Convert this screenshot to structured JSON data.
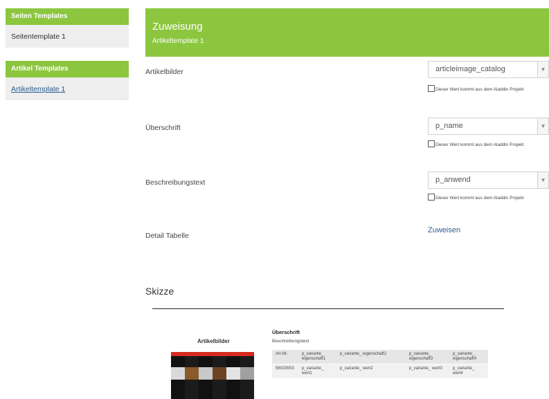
{
  "sidebar": {
    "page_templates_heading": "Seiten Templates",
    "page_template_item": "Seitentemplate 1",
    "article_templates_heading": "Artikel Templates",
    "article_template_item": "Artikeltemplate 1"
  },
  "header": {
    "title": "Zuweisung",
    "subtitle": "Artikeltemplate 1"
  },
  "fields": [
    {
      "label": "Artikelbilder",
      "value": "articleimage_catalog",
      "checkbox_label": "Dieser Wert kommt aus dem Aladdin Projekt"
    },
    {
      "label": "Überschrift",
      "value": "p_name",
      "checkbox_label": "Dieser Wert kommt aus dem Aladdin Projekt"
    },
    {
      "label": "Beschreibungstext",
      "value": "p_anwend",
      "checkbox_label": "Dieser Wert kommt aus dem Aladdin Projekt"
    }
  ],
  "detail_table": {
    "label": "Detail Tabelle",
    "action": "Zuweisen"
  },
  "sketch": {
    "title": "Skizze",
    "image_label": "Artikelbilder",
    "heading": "Überschrift",
    "description": "Beschreibungstext",
    "table_header": [
      "Art-Nr.",
      "p_variante_ eigenschaft1",
      "p_variante_ eigenschaft2",
      "p_variante_ eigenschaft3",
      "p_variante_ eigenschaft4"
    ],
    "table_row": [
      "56023003",
      "p_variante_ wert1",
      "p_variante_ wert2",
      "p_variante_ wert3",
      "p_variante_ wert4"
    ]
  },
  "colors": {
    "accent": "#8cc63f",
    "link": "#2a5d8f",
    "panel": "#eeeeee"
  },
  "icons": {
    "select_caret": "chevron-down-icon",
    "checkbox": "checkbox-icon"
  }
}
